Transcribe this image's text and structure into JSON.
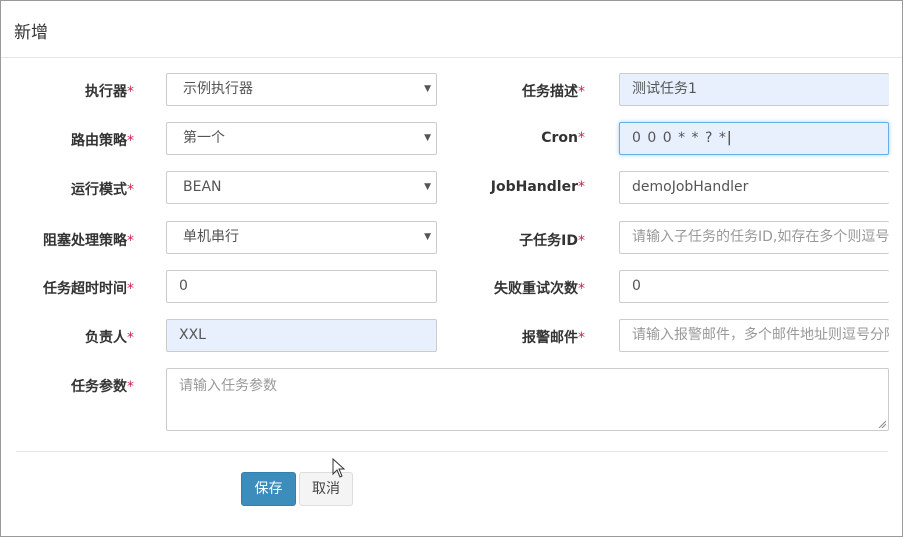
{
  "dialog": {
    "title": "新增"
  },
  "form": {
    "executor": {
      "label": "执行器",
      "value": "示例执行器"
    },
    "route_strategy": {
      "label": "路由策略",
      "value": "第一个"
    },
    "run_mode": {
      "label": "运行模式",
      "value": "BEAN"
    },
    "block_strategy": {
      "label": "阻塞处理策略",
      "value": "单机串行"
    },
    "timeout": {
      "label": "任务超时时间",
      "value": "0"
    },
    "author": {
      "label": "负责人",
      "value": "XXL"
    },
    "job_param": {
      "label": "任务参数",
      "placeholder": "请输入任务参数"
    },
    "job_desc": {
      "label": "任务描述",
      "value": "测试任务1"
    },
    "cron": {
      "label": "Cron",
      "value": "0 0 0 * * ? *"
    },
    "job_handler": {
      "label": "JobHandler",
      "value": "demoJobHandler"
    },
    "child_job_id": {
      "label": "子任务ID",
      "placeholder": "请输入子任务的任务ID,如存在多个则逗号分隔"
    },
    "fail_retry": {
      "label": "失败重试次数",
      "value": "0"
    },
    "alarm_email": {
      "label": "报警邮件",
      "placeholder": "请输入报警邮件，多个邮件地址则逗号分隔"
    },
    "required_mark": "*"
  },
  "footer": {
    "save_label": "保存",
    "cancel_label": "取消"
  },
  "colors": {
    "primary": "#3c8dbc",
    "required": "#c7254e",
    "autofill": "#e8f0fe"
  }
}
